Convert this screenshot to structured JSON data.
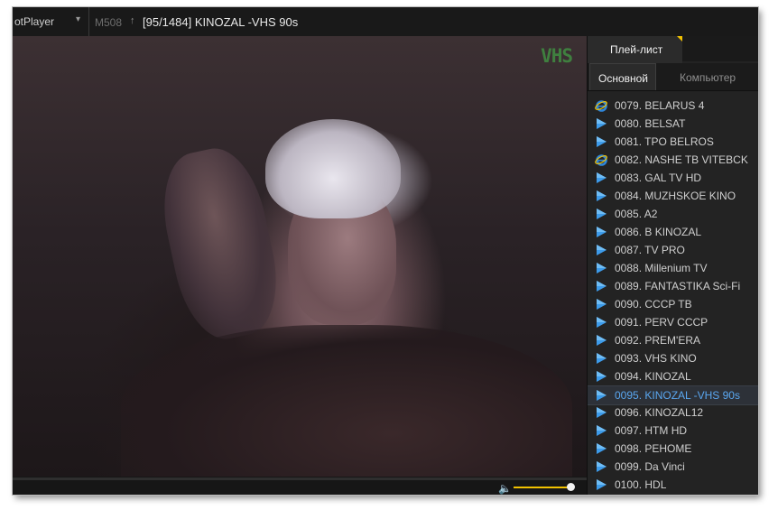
{
  "window": {
    "app_name": "otPlayer",
    "inactive_tab": "M508",
    "pin_glyph": "↑",
    "title": "[95/1484] KINOZAL -VHS 90s"
  },
  "video": {
    "watermark": "VHS",
    "playback_progress": 0.0,
    "volume": 1.0
  },
  "panel": {
    "tab_label": "Плей-лист",
    "subtabs": {
      "main": "Основной",
      "computer": "Компьютер"
    }
  },
  "playlist": [
    {
      "label": "0079. BELARUS 4",
      "icon": "ie-icon"
    },
    {
      "label": "0080. BELSAT",
      "icon": "play-icon"
    },
    {
      "label": "0081. TPO BELROS",
      "icon": "play-icon"
    },
    {
      "label": "0082. NASHE TB VITEBCK",
      "icon": "ie-icon"
    },
    {
      "label": "0083. GAL TV HD",
      "icon": "play-icon"
    },
    {
      "label": "0084. MUZHSKOE KINO",
      "icon": "play-icon"
    },
    {
      "label": "0085. A2",
      "icon": "play-icon"
    },
    {
      "label": "0086. B KINOZAL",
      "icon": "play-icon"
    },
    {
      "label": "0087. TV PRO",
      "icon": "play-icon"
    },
    {
      "label": "0088. Millenium TV",
      "icon": "play-icon"
    },
    {
      "label": "0089. FANTASTIKA Sci-Fi",
      "icon": "play-icon"
    },
    {
      "label": "0090. CCCP TB",
      "icon": "play-icon"
    },
    {
      "label": "0091. PERV CCCP",
      "icon": "play-icon"
    },
    {
      "label": "0092. PREM'ERA",
      "icon": "play-icon"
    },
    {
      "label": "0093. VHS KINO",
      "icon": "play-icon"
    },
    {
      "label": "0094. KINOZAL",
      "icon": "play-icon"
    },
    {
      "label": "0095. KINOZAL -VHS 90s",
      "icon": "play-icon",
      "active": true
    },
    {
      "label": "0096. KINOZAL12",
      "icon": "play-icon"
    },
    {
      "label": "0097. HTM HD",
      "icon": "play-icon"
    },
    {
      "label": "0098. PEHOME",
      "icon": "play-icon"
    },
    {
      "label": "0099. Da Vinci",
      "icon": "play-icon"
    },
    {
      "label": "0100. HDL",
      "icon": "play-icon"
    }
  ],
  "colors": {
    "accent_yellow": "#f2c200",
    "active_text": "#5aa7f0",
    "play_icon": "#3d9be9",
    "background": "#1c1c1c"
  }
}
